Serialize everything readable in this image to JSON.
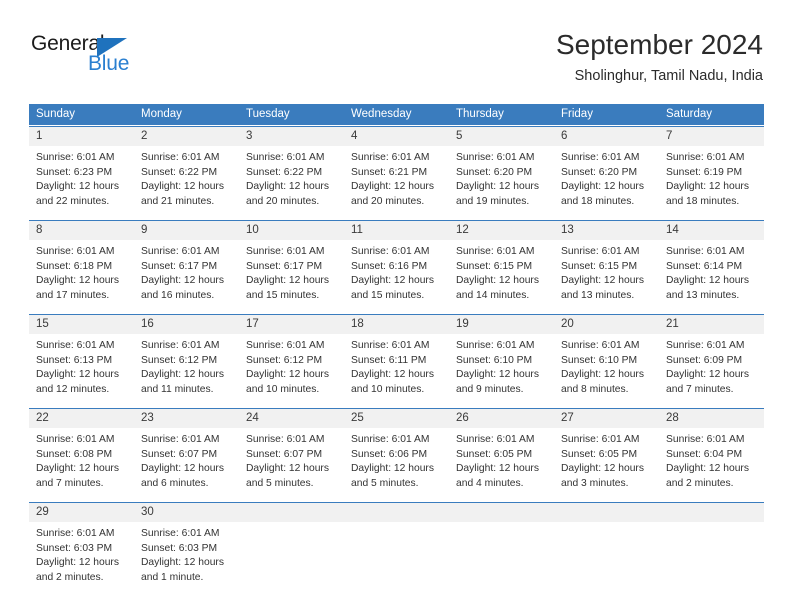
{
  "brand": {
    "name_top": "General",
    "name_bottom": "Blue",
    "accent_color": "#2a7fd0",
    "triangle_color": "#1f72bd"
  },
  "header": {
    "title": "September 2024",
    "subtitle": "Sholinghur, Tamil Nadu, India"
  },
  "theme": {
    "header_row_bg": "#3a7cbe",
    "day_band_bg": "#f1f1f1",
    "row_divider": "#3a7cbe",
    "text": "#333333"
  },
  "weekdays": [
    "Sunday",
    "Monday",
    "Tuesday",
    "Wednesday",
    "Thursday",
    "Friday",
    "Saturday"
  ],
  "weeks": [
    [
      {
        "date": "1",
        "lines": [
          "Sunrise: 6:01 AM",
          "Sunset: 6:23 PM",
          "Daylight: 12 hours",
          "and 22 minutes."
        ]
      },
      {
        "date": "2",
        "lines": [
          "Sunrise: 6:01 AM",
          "Sunset: 6:22 PM",
          "Daylight: 12 hours",
          "and 21 minutes."
        ]
      },
      {
        "date": "3",
        "lines": [
          "Sunrise: 6:01 AM",
          "Sunset: 6:22 PM",
          "Daylight: 12 hours",
          "and 20 minutes."
        ]
      },
      {
        "date": "4",
        "lines": [
          "Sunrise: 6:01 AM",
          "Sunset: 6:21 PM",
          "Daylight: 12 hours",
          "and 20 minutes."
        ]
      },
      {
        "date": "5",
        "lines": [
          "Sunrise: 6:01 AM",
          "Sunset: 6:20 PM",
          "Daylight: 12 hours",
          "and 19 minutes."
        ]
      },
      {
        "date": "6",
        "lines": [
          "Sunrise: 6:01 AM",
          "Sunset: 6:20 PM",
          "Daylight: 12 hours",
          "and 18 minutes."
        ]
      },
      {
        "date": "7",
        "lines": [
          "Sunrise: 6:01 AM",
          "Sunset: 6:19 PM",
          "Daylight: 12 hours",
          "and 18 minutes."
        ]
      }
    ],
    [
      {
        "date": "8",
        "lines": [
          "Sunrise: 6:01 AM",
          "Sunset: 6:18 PM",
          "Daylight: 12 hours",
          "and 17 minutes."
        ]
      },
      {
        "date": "9",
        "lines": [
          "Sunrise: 6:01 AM",
          "Sunset: 6:17 PM",
          "Daylight: 12 hours",
          "and 16 minutes."
        ]
      },
      {
        "date": "10",
        "lines": [
          "Sunrise: 6:01 AM",
          "Sunset: 6:17 PM",
          "Daylight: 12 hours",
          "and 15 minutes."
        ]
      },
      {
        "date": "11",
        "lines": [
          "Sunrise: 6:01 AM",
          "Sunset: 6:16 PM",
          "Daylight: 12 hours",
          "and 15 minutes."
        ]
      },
      {
        "date": "12",
        "lines": [
          "Sunrise: 6:01 AM",
          "Sunset: 6:15 PM",
          "Daylight: 12 hours",
          "and 14 minutes."
        ]
      },
      {
        "date": "13",
        "lines": [
          "Sunrise: 6:01 AM",
          "Sunset: 6:15 PM",
          "Daylight: 12 hours",
          "and 13 minutes."
        ]
      },
      {
        "date": "14",
        "lines": [
          "Sunrise: 6:01 AM",
          "Sunset: 6:14 PM",
          "Daylight: 12 hours",
          "and 13 minutes."
        ]
      }
    ],
    [
      {
        "date": "15",
        "lines": [
          "Sunrise: 6:01 AM",
          "Sunset: 6:13 PM",
          "Daylight: 12 hours",
          "and 12 minutes."
        ]
      },
      {
        "date": "16",
        "lines": [
          "Sunrise: 6:01 AM",
          "Sunset: 6:12 PM",
          "Daylight: 12 hours",
          "and 11 minutes."
        ]
      },
      {
        "date": "17",
        "lines": [
          "Sunrise: 6:01 AM",
          "Sunset: 6:12 PM",
          "Daylight: 12 hours",
          "and 10 minutes."
        ]
      },
      {
        "date": "18",
        "lines": [
          "Sunrise: 6:01 AM",
          "Sunset: 6:11 PM",
          "Daylight: 12 hours",
          "and 10 minutes."
        ]
      },
      {
        "date": "19",
        "lines": [
          "Sunrise: 6:01 AM",
          "Sunset: 6:10 PM",
          "Daylight: 12 hours",
          "and 9 minutes."
        ]
      },
      {
        "date": "20",
        "lines": [
          "Sunrise: 6:01 AM",
          "Sunset: 6:10 PM",
          "Daylight: 12 hours",
          "and 8 minutes."
        ]
      },
      {
        "date": "21",
        "lines": [
          "Sunrise: 6:01 AM",
          "Sunset: 6:09 PM",
          "Daylight: 12 hours",
          "and 7 minutes."
        ]
      }
    ],
    [
      {
        "date": "22",
        "lines": [
          "Sunrise: 6:01 AM",
          "Sunset: 6:08 PM",
          "Daylight: 12 hours",
          "and 7 minutes."
        ]
      },
      {
        "date": "23",
        "lines": [
          "Sunrise: 6:01 AM",
          "Sunset: 6:07 PM",
          "Daylight: 12 hours",
          "and 6 minutes."
        ]
      },
      {
        "date": "24",
        "lines": [
          "Sunrise: 6:01 AM",
          "Sunset: 6:07 PM",
          "Daylight: 12 hours",
          "and 5 minutes."
        ]
      },
      {
        "date": "25",
        "lines": [
          "Sunrise: 6:01 AM",
          "Sunset: 6:06 PM",
          "Daylight: 12 hours",
          "and 5 minutes."
        ]
      },
      {
        "date": "26",
        "lines": [
          "Sunrise: 6:01 AM",
          "Sunset: 6:05 PM",
          "Daylight: 12 hours",
          "and 4 minutes."
        ]
      },
      {
        "date": "27",
        "lines": [
          "Sunrise: 6:01 AM",
          "Sunset: 6:05 PM",
          "Daylight: 12 hours",
          "and 3 minutes."
        ]
      },
      {
        "date": "28",
        "lines": [
          "Sunrise: 6:01 AM",
          "Sunset: 6:04 PM",
          "Daylight: 12 hours",
          "and 2 minutes."
        ]
      }
    ],
    [
      {
        "date": "29",
        "lines": [
          "Sunrise: 6:01 AM",
          "Sunset: 6:03 PM",
          "Daylight: 12 hours",
          "and 2 minutes."
        ]
      },
      {
        "date": "30",
        "lines": [
          "Sunrise: 6:01 AM",
          "Sunset: 6:03 PM",
          "Daylight: 12 hours",
          "and 1 minute."
        ]
      },
      {
        "date": "",
        "lines": []
      },
      {
        "date": "",
        "lines": []
      },
      {
        "date": "",
        "lines": []
      },
      {
        "date": "",
        "lines": []
      },
      {
        "date": "",
        "lines": []
      }
    ]
  ]
}
